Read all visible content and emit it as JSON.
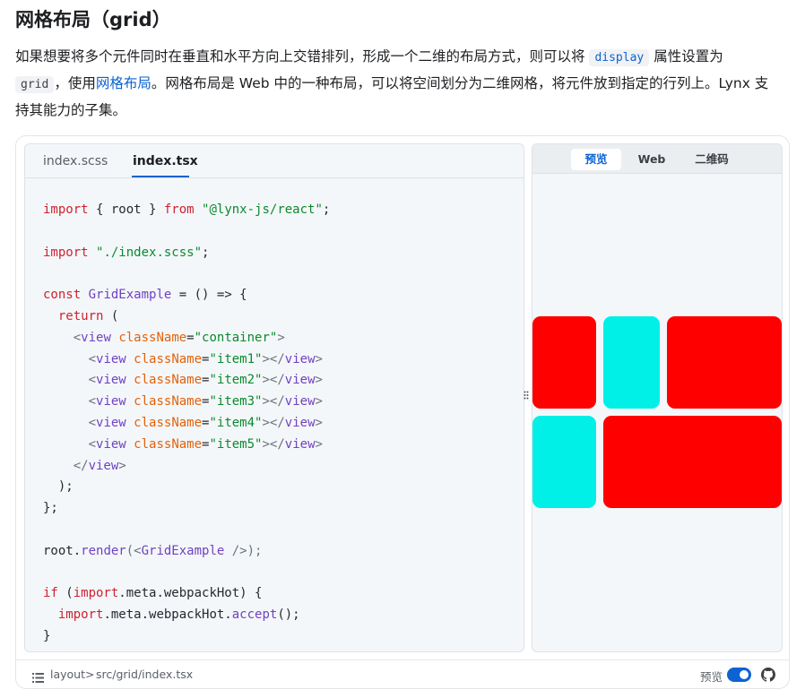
{
  "heading": "网格布局（grid）",
  "intro": {
    "line1_a": "如果想要将多个元件同时在垂直和水平方向上交错排列，形成一个二维的布局方式，则可以将",
    "line1_chip": "display",
    "line1_b": "属性设置为",
    "line2_chip": "grid",
    "line2_a": "，使用",
    "line2_link": "网格布局",
    "line2_b": "。网格布局是 Web 中的一种布局，可以将空间划分为二维网格，将元件放到指定的行列上。Lynx 支",
    "line3": "持其能力的子集。"
  },
  "editor": {
    "tabs": [
      {
        "label": "index.scss",
        "active": false
      },
      {
        "label": "index.tsx",
        "active": true
      }
    ],
    "code": {
      "l1": {
        "kw": "import",
        "a": " { root } ",
        "kw2": "from",
        "sp": " ",
        "str": "\"@lynx-js/react\"",
        "end": ";"
      },
      "l3": {
        "kw": "import",
        "sp": " ",
        "str": "\"./index.scss\"",
        "end": ";"
      },
      "l5": {
        "kw": "const",
        "sp": " ",
        "fn": "GridExample",
        "rest": " = () => {"
      },
      "l6": {
        "ind": "  ",
        "kw": "return",
        "rest": " ("
      },
      "l7": {
        "ind": "    ",
        "lt": "<",
        "tag": "view",
        "sp": " ",
        "attr": "className",
        "eq": "=",
        "str": "\"container\"",
        "gt": ">"
      },
      "items": [
        {
          "ind": "      ",
          "lt": "<",
          "tag": "view",
          "sp": " ",
          "attr": "className",
          "eq": "=",
          "str": "\"item1\"",
          "mid": "></",
          "tag2": "view",
          "gt": ">"
        },
        {
          "ind": "      ",
          "lt": "<",
          "tag": "view",
          "sp": " ",
          "attr": "className",
          "eq": "=",
          "str": "\"item2\"",
          "mid": "></",
          "tag2": "view",
          "gt": ">"
        },
        {
          "ind": "      ",
          "lt": "<",
          "tag": "view",
          "sp": " ",
          "attr": "className",
          "eq": "=",
          "str": "\"item3\"",
          "mid": "></",
          "tag2": "view",
          "gt": ">"
        },
        {
          "ind": "      ",
          "lt": "<",
          "tag": "view",
          "sp": " ",
          "attr": "className",
          "eq": "=",
          "str": "\"item4\"",
          "mid": "></",
          "tag2": "view",
          "gt": ">"
        },
        {
          "ind": "      ",
          "lt": "<",
          "tag": "view",
          "sp": " ",
          "attr": "className",
          "eq": "=",
          "str": "\"item5\"",
          "mid": "></",
          "tag2": "view",
          "gt": ">"
        }
      ],
      "l13": {
        "ind": "    ",
        "lt": "</",
        "tag": "view",
        "gt": ">"
      },
      "l14": "  );",
      "l15": "};",
      "l17": {
        "a": "root",
        "dot": ".",
        "fn": "render",
        "lt": "(<",
        "fn2": "GridExample",
        "end": " />);"
      },
      "l19": {
        "kw": "if",
        "a": " (",
        "kw2": "import",
        "b": ".meta.webpackHot) {"
      },
      "l20": {
        "ind": "  ",
        "kw": "import",
        "b": ".meta.webpackHot.",
        "fn": "accept",
        "end": "();"
      },
      "l21": "}"
    }
  },
  "preview": {
    "tabs": [
      {
        "label": "预览",
        "active": true
      },
      {
        "label": "Web",
        "active": false
      },
      {
        "label": "二维码",
        "active": false
      }
    ],
    "colors": {
      "red": "#ff0000",
      "cyan": "#00f0e8"
    },
    "cells": [
      "item1",
      "item2",
      "item3",
      "item4",
      "item5"
    ]
  },
  "footer": {
    "crumb_root": "layout",
    "crumb_sep": ">",
    "crumb_path": "src/grid/index.tsx",
    "toggle_label": "预览",
    "toggle_on": true
  },
  "icons": {
    "menu": "list-icon",
    "github": "github-icon",
    "splitter": "drag-handle-icon"
  }
}
